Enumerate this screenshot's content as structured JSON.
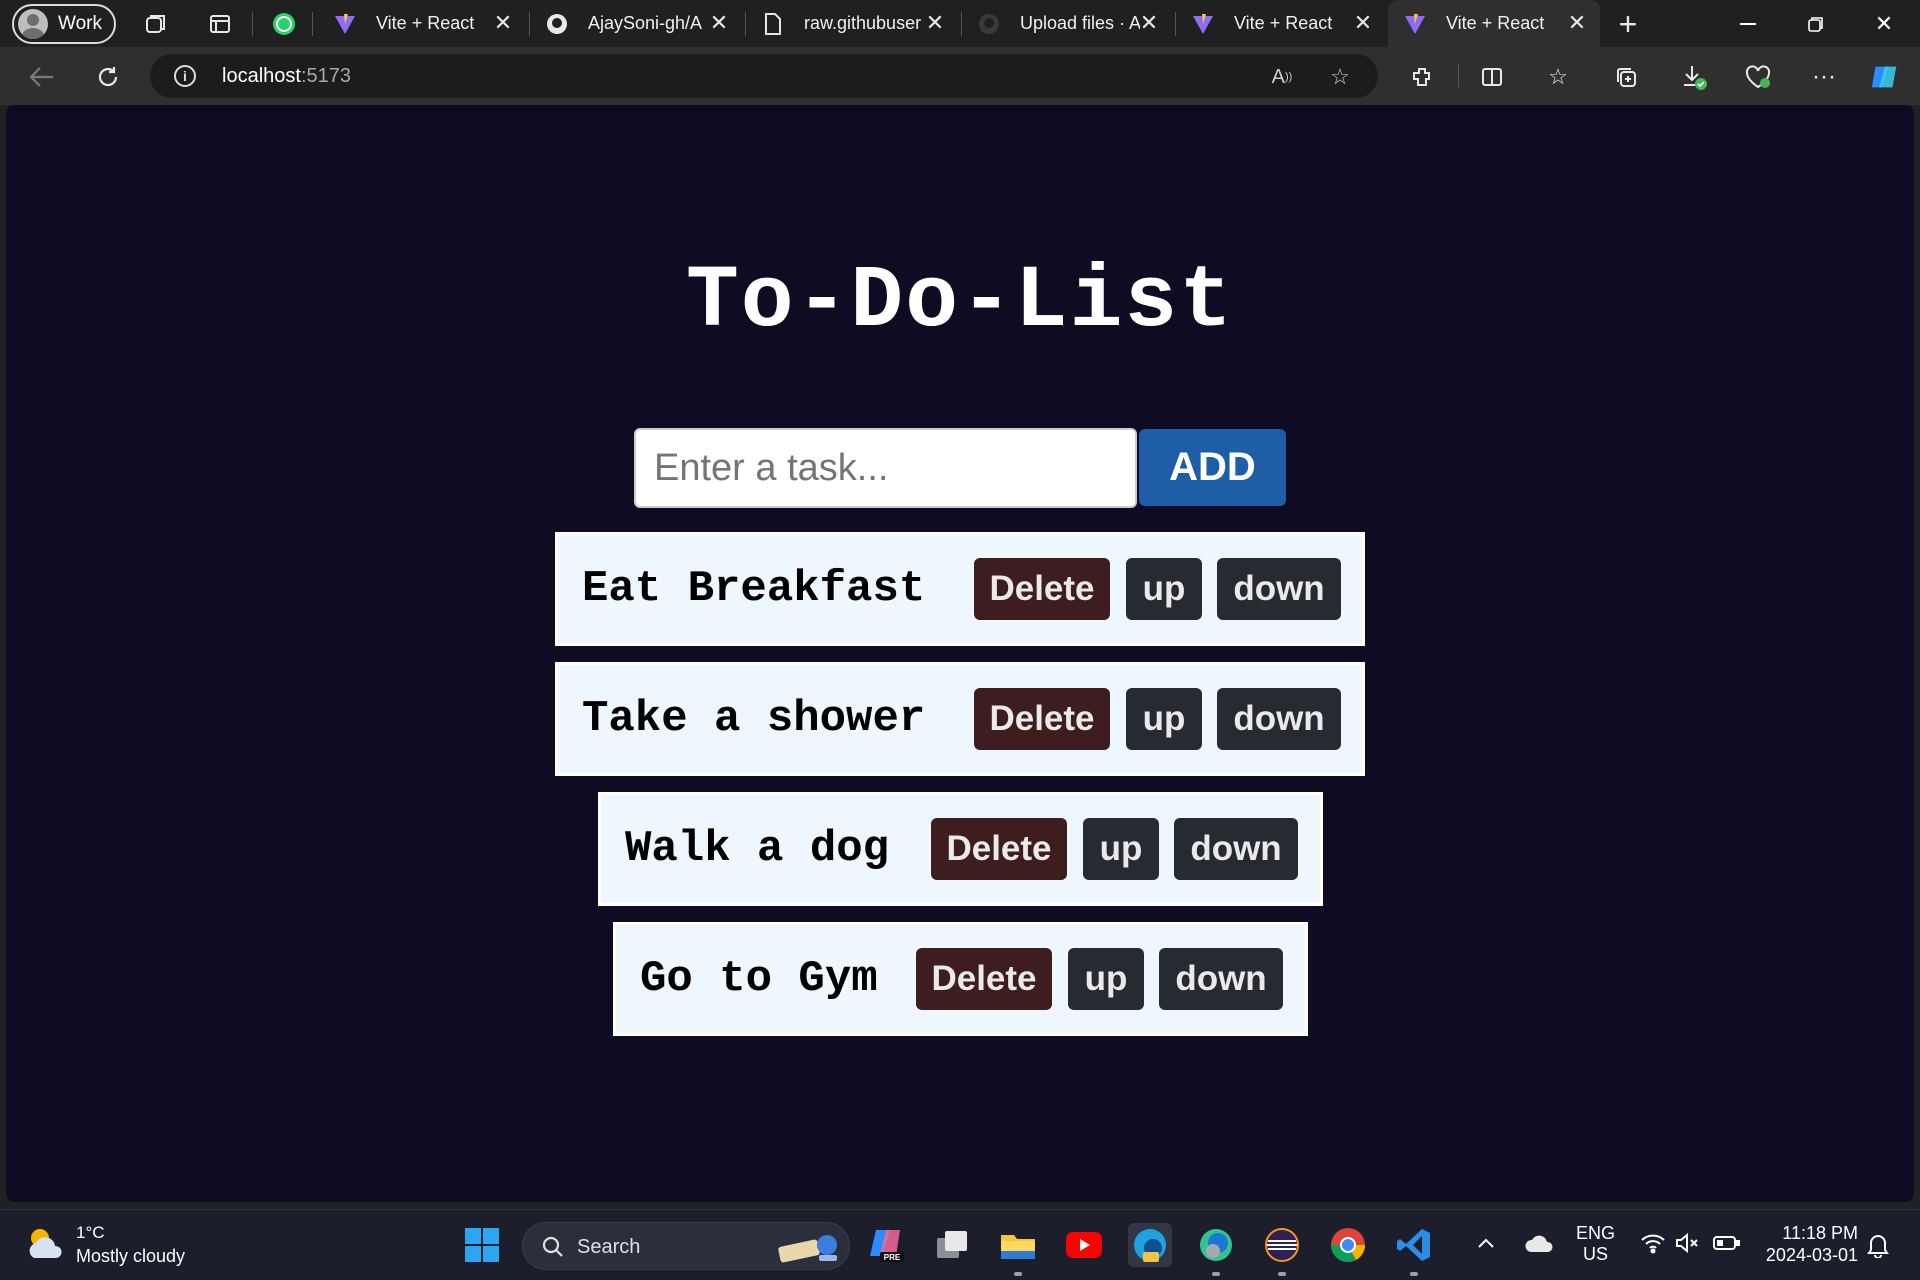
{
  "browser": {
    "profile_label": "Work",
    "tabs": [
      {
        "title": "Vite + React",
        "icon": "vite-icon",
        "active": false
      },
      {
        "title": "AjaySoni-gh/A",
        "icon": "github-icon",
        "active": false
      },
      {
        "title": "raw.githubuser",
        "icon": "document-icon",
        "active": false
      },
      {
        "title": "Upload files · A",
        "icon": "github-icon",
        "active": false
      },
      {
        "title": "Vite + React",
        "icon": "vite-icon",
        "active": false
      },
      {
        "title": "Vite + React",
        "icon": "vite-icon",
        "active": true
      }
    ],
    "address": {
      "host": "localhost",
      "port": ":5173"
    }
  },
  "app": {
    "title": "To-Do-List",
    "input_placeholder": "Enter a task...",
    "input_value": "",
    "add_label": "ADD",
    "tasks": [
      {
        "text": "Eat Breakfast",
        "delete_label": "Delete",
        "up_label": "up",
        "down_label": "down"
      },
      {
        "text": "Take a shower",
        "delete_label": "Delete",
        "up_label": "up",
        "down_label": "down"
      },
      {
        "text": "Walk a dog",
        "delete_label": "Delete",
        "up_label": "up",
        "down_label": "down"
      },
      {
        "text": "Go to Gym",
        "delete_label": "Delete",
        "up_label": "up",
        "down_label": "down"
      }
    ]
  },
  "taskbar": {
    "weather_temp": "1°C",
    "weather_condition": "Mostly cloudy",
    "search_label": "Search",
    "lang_top": "ENG",
    "lang_bottom": "US",
    "time": "11:18 PM",
    "date": "2024-03-01"
  },
  "colors": {
    "page_background": "#0f0b22",
    "add_button": "#1d5ea7",
    "delete_button": "#3e1d1f",
    "move_button": "#272a31",
    "task_background": "#eef6fe"
  }
}
